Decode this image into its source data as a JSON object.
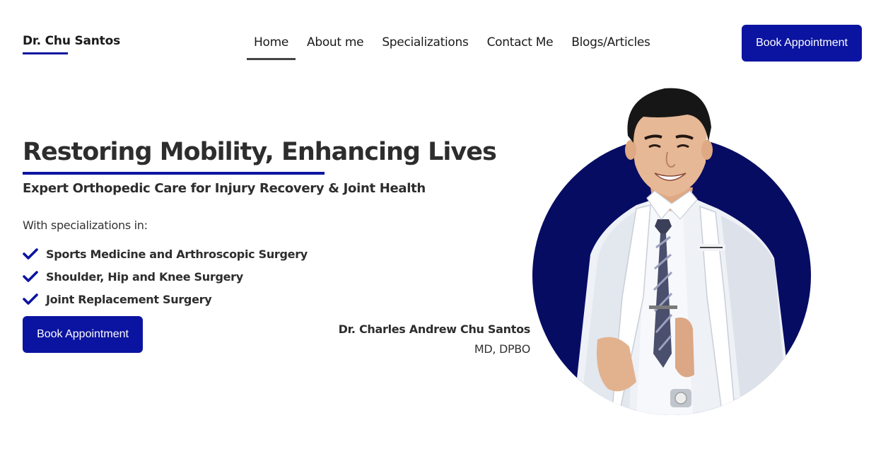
{
  "header": {
    "logo": "Dr. Chu Santos",
    "nav": [
      {
        "label": "Home",
        "active": true
      },
      {
        "label": "About me",
        "active": false
      },
      {
        "label": "Specializations",
        "active": false
      },
      {
        "label": "Contact Me",
        "active": false
      },
      {
        "label": "Blogs/Articles",
        "active": false
      }
    ],
    "cta_label": "Book Appointment"
  },
  "hero": {
    "title": "Restoring Mobility, Enhancing Lives",
    "subtitle": "Expert Orthopedic Care for Injury Recovery & Joint Health",
    "spec_intro": "With specializations in:",
    "specializations": [
      "Sports Medicine and Arthroscopic Surgery",
      "Shoulder, Hip and Knee Surgery",
      "Joint Replacement Surgery"
    ],
    "cta_label": "Book Appointment"
  },
  "doctor": {
    "name": "Dr. Charles Andrew Chu Santos",
    "credentials": "MD, DPBO"
  },
  "colors": {
    "accent": "#0b14a0",
    "circle": "#070c63",
    "text": "#2d2d2d"
  },
  "icons": {
    "check": "check-icon",
    "portrait": "doctor-portrait"
  }
}
